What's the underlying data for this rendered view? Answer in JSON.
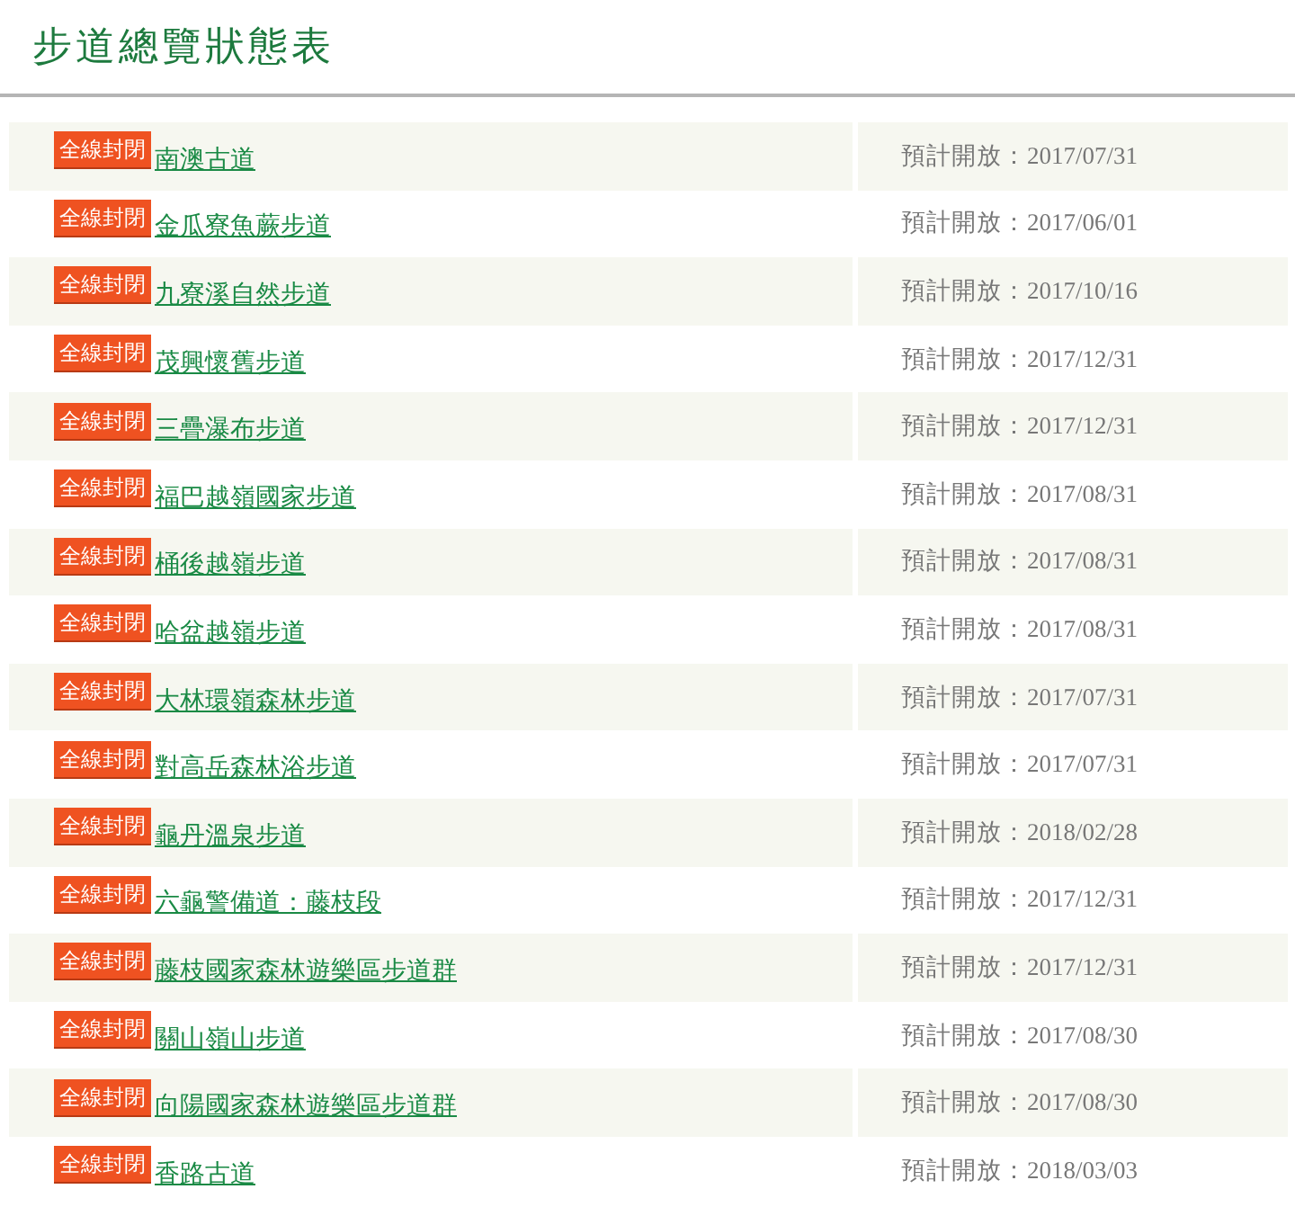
{
  "title": "步道總覽狀態表",
  "trails": [
    {
      "status": "全線封閉",
      "name": "南澳古道",
      "reopen": "預計開放：2017/07/31"
    },
    {
      "status": "全線封閉",
      "name": "金瓜寮魚蕨步道",
      "reopen": "預計開放：2017/06/01"
    },
    {
      "status": "全線封閉",
      "name": "九寮溪自然步道",
      "reopen": "預計開放：2017/10/16"
    },
    {
      "status": "全線封閉",
      "name": "茂興懷舊步道",
      "reopen": "預計開放：2017/12/31"
    },
    {
      "status": "全線封閉",
      "name": "三疊瀑布步道",
      "reopen": "預計開放：2017/12/31"
    },
    {
      "status": "全線封閉",
      "name": "福巴越嶺國家步道",
      "reopen": "預計開放：2017/08/31"
    },
    {
      "status": "全線封閉",
      "name": "桶後越嶺步道",
      "reopen": "預計開放：2017/08/31"
    },
    {
      "status": "全線封閉",
      "name": "哈盆越嶺步道",
      "reopen": "預計開放：2017/08/31"
    },
    {
      "status": "全線封閉",
      "name": "大林環嶺森林步道",
      "reopen": "預計開放：2017/07/31"
    },
    {
      "status": "全線封閉",
      "name": "對高岳森林浴步道",
      "reopen": "預計開放：2017/07/31"
    },
    {
      "status": "全線封閉",
      "name": "龜丹溫泉步道",
      "reopen": "預計開放：2018/02/28"
    },
    {
      "status": "全線封閉",
      "name": "六龜警備道：藤枝段",
      "reopen": "預計開放：2017/12/31"
    },
    {
      "status": "全線封閉",
      "name": "藤枝國家森林遊樂區步道群",
      "reopen": "預計開放：2017/12/31"
    },
    {
      "status": "全線封閉",
      "name": "關山嶺山步道",
      "reopen": "預計開放：2017/08/30"
    },
    {
      "status": "全線封閉",
      "name": "向陽國家森林遊樂區步道群",
      "reopen": "預計開放：2017/08/30"
    },
    {
      "status": "全線封閉",
      "name": "香路古道",
      "reopen": "預計開放：2018/03/03"
    }
  ]
}
